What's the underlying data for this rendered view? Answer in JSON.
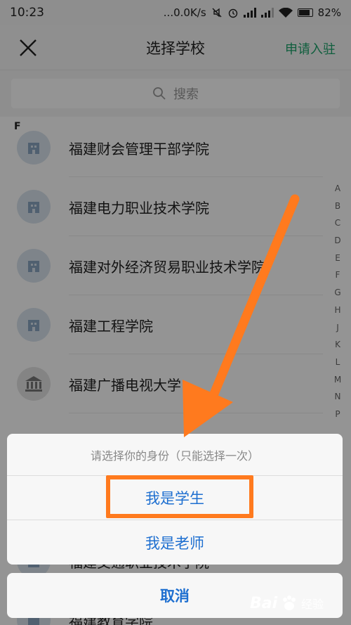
{
  "status_bar": {
    "time": "10:23",
    "network_speed": "...0.0K/s",
    "battery": "82%"
  },
  "nav": {
    "title": "选择学校",
    "apply_label": "申请入驻"
  },
  "search": {
    "placeholder": "搜索"
  },
  "section_letter": "F",
  "schools": [
    {
      "name": "福建财会管理干部学院",
      "logo": "school-building-icon"
    },
    {
      "name": "福建电力职业技术学院",
      "logo": "school-building-icon"
    },
    {
      "name": "福建对外经济贸易职业技术学院",
      "logo": "school-building-icon"
    },
    {
      "name": "福建工程学院",
      "logo": "school-building-icon"
    },
    {
      "name": "福建广播电视大学",
      "logo": "university-columns-icon"
    },
    {
      "name": "福建交通职业技术学院",
      "logo": "school-building-icon"
    },
    {
      "name": "福建教育学院",
      "logo": "school-building-icon"
    }
  ],
  "index_letters": [
    "A",
    "B",
    "C",
    "D",
    "E",
    "F",
    "G",
    "H",
    "J",
    "K",
    "L",
    "M",
    "N",
    "P"
  ],
  "dialog": {
    "title": "请选择你的身份（只能选择一次）",
    "option_student": "我是学生",
    "option_teacher": "我是老师",
    "cancel": "取消"
  },
  "watermark": {
    "brand": "Bai",
    "suffix": "经验"
  },
  "colors": {
    "accent_green": "#1aa36a",
    "action_blue": "#1e6fd0",
    "annotation_orange": "#ff7a1e"
  }
}
